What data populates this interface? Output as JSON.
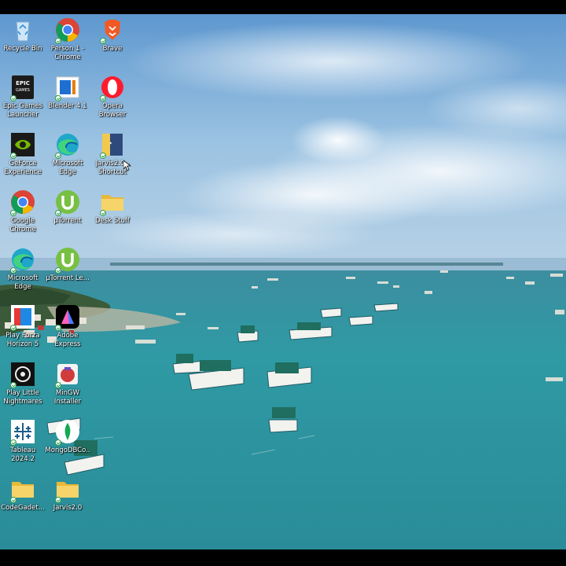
{
  "desktop": {
    "icons": [
      {
        "label": "Recycle Bin",
        "icon": "recycle-bin-icon"
      },
      {
        "label": "Person 1 - Chrome",
        "icon": "chrome-icon"
      },
      {
        "label": "Brave",
        "icon": "brave-icon"
      },
      {
        "label": "Epic Games Launcher",
        "icon": "epic-games-icon",
        "logo_text": "EPIC GAMES"
      },
      {
        "label": "Blender 4.1",
        "icon": "blender-icon"
      },
      {
        "label": "Opera Browser",
        "icon": "opera-icon"
      },
      {
        "label": "GeForce Experience",
        "icon": "geforce-icon"
      },
      {
        "label": "Microsoft Edge",
        "icon": "edge-icon"
      },
      {
        "label": "Jarvis2.0 - Shortcut",
        "icon": "shortcut-icon"
      },
      {
        "label": "Google Chrome",
        "icon": "chrome-icon"
      },
      {
        "label": "µTorrent",
        "icon": "utorrent-icon"
      },
      {
        "label": "Desk Stuff",
        "icon": "folder-icon"
      },
      {
        "label": "Microsoft Edge",
        "icon": "edge-icon"
      },
      {
        "label": "µTorrent Le...",
        "icon": "utorrent-icon"
      },
      {
        "label": "Play Forza Horizon 5",
        "icon": "forza-icon"
      },
      {
        "label": "Adobe Express",
        "icon": "adobe-express-icon"
      },
      {
        "label": "Play Little Nightmares",
        "icon": "little-nightmares-icon"
      },
      {
        "label": "MinGW Installer",
        "icon": "mingw-icon"
      },
      {
        "label": "Tableau 2024.2",
        "icon": "tableau-icon"
      },
      {
        "label": "MongoDBCo...",
        "icon": "mongodb-icon"
      },
      {
        "label": "CodeGadet...",
        "icon": "folder-icon"
      },
      {
        "label": "Jarvis2.0",
        "icon": "folder-icon"
      }
    ]
  },
  "colors": {
    "sky": "#7fb3dc",
    "sea": "#2f9aa4",
    "label_text": "#ffffff"
  }
}
